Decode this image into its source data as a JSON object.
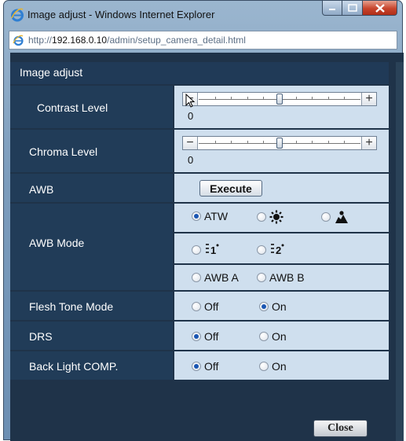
{
  "window": {
    "title": "Image adjust - Windows Internet Explorer",
    "address_prefix": "http://",
    "address_host": "192.168.0.10",
    "address_path": "/admin/setup_camera_detail.html"
  },
  "panel": {
    "title": "Image adjust"
  },
  "rows": {
    "contrast": {
      "label": "Contrast Level",
      "value": "0",
      "level_fraction": 0.5
    },
    "chroma": {
      "label": "Chroma Level",
      "value": "0",
      "level_fraction": 0.5
    },
    "awb": {
      "label": "AWB",
      "button": "Execute"
    },
    "awb_mode": {
      "label": "AWB Mode",
      "options": {
        "atw": "ATW",
        "awb_a": "AWB A",
        "awb_b": "AWB B"
      },
      "icons": [
        "indoor-light-icon",
        "outdoor-sunlight-icon",
        "fluorescent-1-icon",
        "fluorescent-2-icon"
      ],
      "selected": "ATW"
    },
    "flesh_tone": {
      "label": "Flesh Tone Mode",
      "off": "Off",
      "on": "On",
      "selected": "On"
    },
    "drs": {
      "label": "DRS",
      "off": "Off",
      "on": "On",
      "selected": "Off"
    },
    "blc": {
      "label": "Back Light COMP.",
      "off": "Off",
      "on": "On",
      "selected": "Off"
    }
  },
  "footer": {
    "close": "Close"
  },
  "colors": {
    "panel": "#213c58",
    "control_bg": "#cfdfee",
    "radio_selected": "#1a56b2"
  }
}
